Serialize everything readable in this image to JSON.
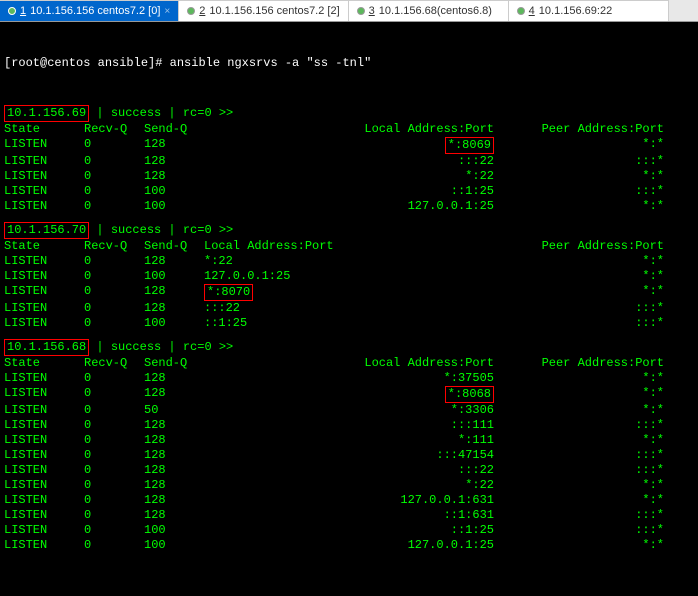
{
  "tabs": [
    {
      "num": "1",
      "label": "10.1.156.156 centos7.2 [0]",
      "active": true
    },
    {
      "num": "2",
      "label": "10.1.156.156 centos7.2 [2]",
      "active": false
    },
    {
      "num": "3",
      "label": "10.1.156.68(centos6.8)",
      "active": false
    },
    {
      "num": "4",
      "label": "10.1.156.69:22",
      "active": false
    }
  ],
  "prompt": "[root@centos ansible]# ",
  "command": "ansible ngxsrvs -a \"ss -tnl\"",
  "result_suffix": " | success | rc=0 >>",
  "table_headers": {
    "state": "State",
    "recvq": "Recv-Q",
    "sendq": "Send-Q",
    "local": "Local Address:Port",
    "peer": "Peer Address:Port"
  },
  "blocks": [
    {
      "host": "10.1.156.69",
      "local_align": "right",
      "rows": [
        {
          "state": "LISTEN",
          "recvq": "0",
          "sendq": "128",
          "local": "*:8069",
          "peer": "*:*",
          "hl": true
        },
        {
          "state": "LISTEN",
          "recvq": "0",
          "sendq": "128",
          "local": ":::22",
          "peer": ":::*"
        },
        {
          "state": "LISTEN",
          "recvq": "0",
          "sendq": "128",
          "local": "*:22",
          "peer": "*:*"
        },
        {
          "state": "LISTEN",
          "recvq": "0",
          "sendq": "100",
          "local": "::1:25",
          "peer": ":::*"
        },
        {
          "state": "LISTEN",
          "recvq": "0",
          "sendq": "100",
          "local": "127.0.0.1:25",
          "peer": "*:*"
        }
      ]
    },
    {
      "host": "10.1.156.70",
      "local_align": "left",
      "rows": [
        {
          "state": "LISTEN",
          "recvq": "0",
          "sendq": "128",
          "local": "*:22",
          "peer": "*:*"
        },
        {
          "state": "LISTEN",
          "recvq": "0",
          "sendq": "100",
          "local": "127.0.0.1:25",
          "peer": "*:*"
        },
        {
          "state": "LISTEN",
          "recvq": "0",
          "sendq": "128",
          "local": "*:8070",
          "peer": "*:*",
          "hl": true
        },
        {
          "state": "LISTEN",
          "recvq": "0",
          "sendq": "128",
          "local": ":::22",
          "peer": ":::*"
        },
        {
          "state": "LISTEN",
          "recvq": "0",
          "sendq": "100",
          "local": "::1:25",
          "peer": ":::*"
        }
      ]
    },
    {
      "host": "10.1.156.68",
      "local_align": "right",
      "rows": [
        {
          "state": "LISTEN",
          "recvq": "0",
          "sendq": "128",
          "local": "*:37505",
          "peer": "*:*"
        },
        {
          "state": "LISTEN",
          "recvq": "0",
          "sendq": "128",
          "local": "*:8068",
          "peer": "*:*",
          "hl": true
        },
        {
          "state": "LISTEN",
          "recvq": "0",
          "sendq": "50",
          "local": "*:3306",
          "peer": "*:*"
        },
        {
          "state": "LISTEN",
          "recvq": "0",
          "sendq": "128",
          "local": ":::111",
          "peer": ":::*"
        },
        {
          "state": "LISTEN",
          "recvq": "0",
          "sendq": "128",
          "local": "*:111",
          "peer": "*:*"
        },
        {
          "state": "LISTEN",
          "recvq": "0",
          "sendq": "128",
          "local": ":::47154",
          "peer": ":::*"
        },
        {
          "state": "LISTEN",
          "recvq": "0",
          "sendq": "128",
          "local": ":::22",
          "peer": ":::*"
        },
        {
          "state": "LISTEN",
          "recvq": "0",
          "sendq": "128",
          "local": "*:22",
          "peer": "*:*"
        },
        {
          "state": "LISTEN",
          "recvq": "0",
          "sendq": "128",
          "local": "127.0.0.1:631",
          "peer": "*:*"
        },
        {
          "state": "LISTEN",
          "recvq": "0",
          "sendq": "128",
          "local": "::1:631",
          "peer": ":::*"
        },
        {
          "state": "LISTEN",
          "recvq": "0",
          "sendq": "100",
          "local": "::1:25",
          "peer": ":::*"
        },
        {
          "state": "LISTEN",
          "recvq": "0",
          "sendq": "100",
          "local": "127.0.0.1:25",
          "peer": "*:*"
        }
      ]
    }
  ]
}
